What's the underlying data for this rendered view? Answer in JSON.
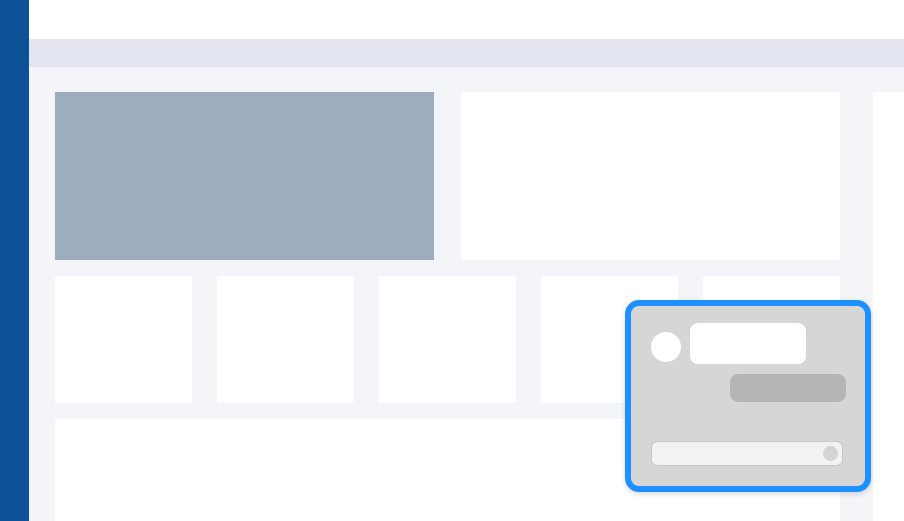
{
  "colors": {
    "rail": "#0d5298",
    "top_bar": "#ffffff",
    "subheader": "#e3e6f1",
    "content_bg": "#f4f5f9",
    "card": "#ffffff",
    "hero_card": "#9eadbd",
    "right_panel": "#ffffff",
    "chat_border": "#1e90ff",
    "chat_bg": "#d6d6d6",
    "chat_bubble_out": "#b5b5b5",
    "chat_send": "#d4d4d4"
  },
  "chat": {
    "avatar_icon": "avatar-circle",
    "send_icon": "send-dot-icon"
  }
}
